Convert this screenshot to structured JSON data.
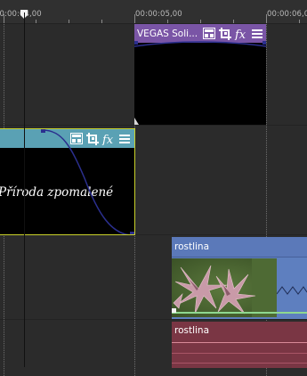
{
  "ruler": {
    "timecodes": [
      "00:00:04,00",
      "00:00:05,00",
      "00:00:06,0"
    ]
  },
  "events": {
    "vegas_solid": {
      "title": "VEGAS Soli...",
      "header_color": "#7a55a6",
      "body_color": "#000000"
    },
    "text_clip": {
      "body_text": "Příroda zpomalené",
      "header_color": "#5aa1b4",
      "body_color": "#000000"
    },
    "rostlina_video": {
      "title": "rostlina",
      "header_color": "#5b79b9",
      "body_color": "#5e7fbf"
    },
    "rostlina_audio": {
      "title": "rostlina",
      "header_color": "#7a3644",
      "body_color": "#7a3644"
    }
  },
  "icons": [
    "event-pan-crop-icon",
    "crop-icon",
    "fx-icon",
    "menu-icon"
  ],
  "colors": {
    "timeline_bg": "#2b2b2b",
    "ruler_bg": "#303030",
    "fade_curve": "#2b2f8e",
    "selection_outline": "#c9d12a",
    "audio_line": "#d88a98",
    "volume_line": "#8fd88f"
  }
}
